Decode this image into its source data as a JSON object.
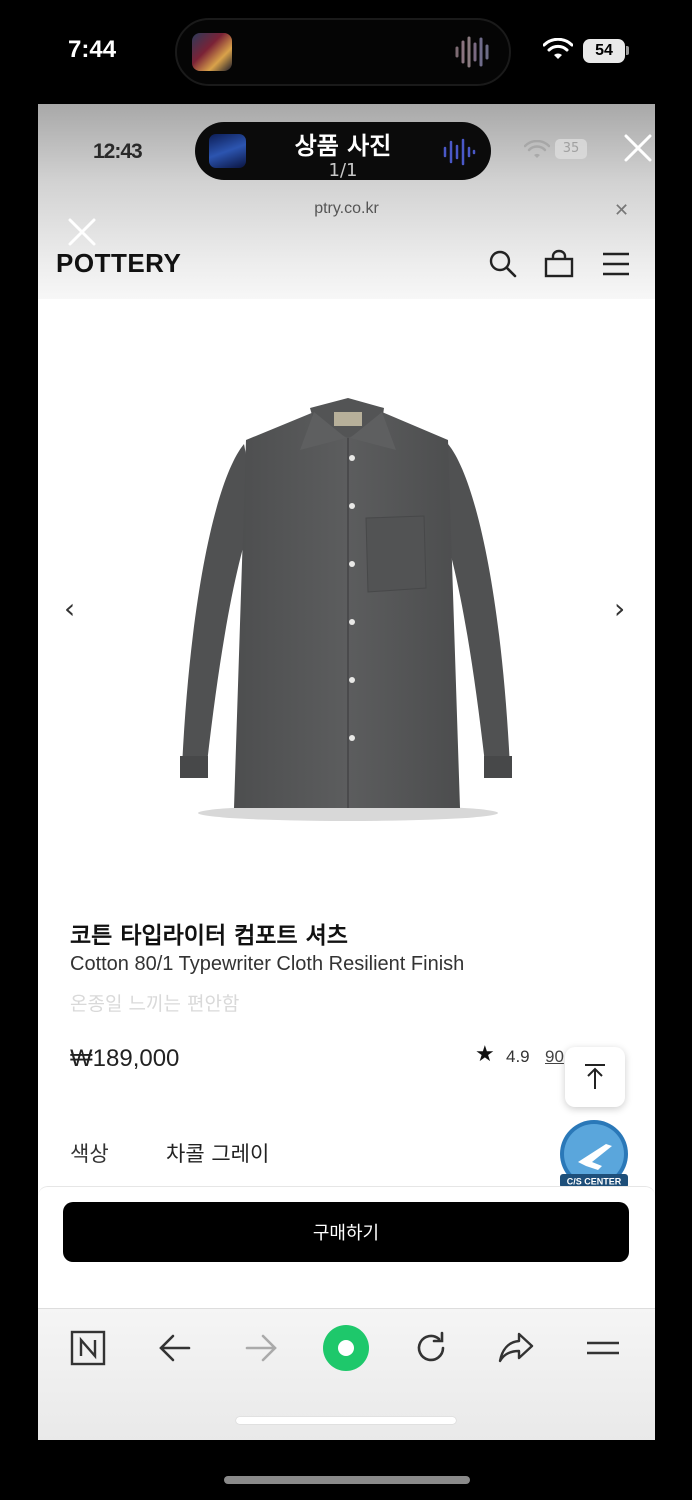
{
  "outer_status": {
    "time": "7:44",
    "battery": "54"
  },
  "viewer": {
    "ghost_time": "12:43",
    "title": "상품 사진",
    "count": "1/1",
    "ghost_battery": "35",
    "url": "ptry.co.kr"
  },
  "site": {
    "logo": "POTTERY"
  },
  "product": {
    "title_ko": "코튼 타입라이터 컴포트 셔츠",
    "title_en": "Cotton 80/1 Typewriter Cloth Resilient Finish",
    "description": "온종일 느끼는 편안함",
    "price": "₩189,000",
    "rating": "4.9",
    "reviews": "90",
    "color_label": "색상",
    "color_value": "차콜 그레이",
    "buy_label": "구매하기",
    "shirt_color": "#575859"
  },
  "cs_badge": {
    "label": "C/S CENTER"
  },
  "icons": {
    "header": [
      "search-icon",
      "cart-icon",
      "menu-icon"
    ],
    "carousel": [
      "chevron-left-icon",
      "chevron-right-icon"
    ],
    "toolbar": [
      "naver-home-icon",
      "back-arrow-icon",
      "forward-arrow-icon",
      "green-dot-icon",
      "refresh-icon",
      "share-icon",
      "menu-icon"
    ]
  },
  "colors": {
    "accent_green": "#1ec86b",
    "buy_button": "#000000"
  }
}
